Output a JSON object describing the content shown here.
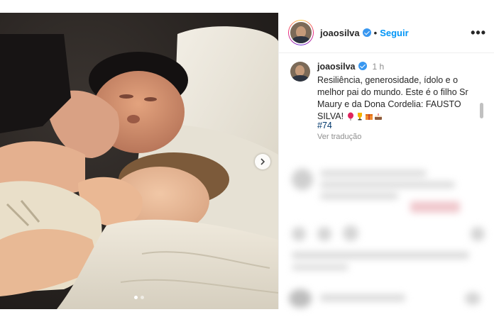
{
  "post": {
    "username": "joaosilva",
    "follow_label": "Seguir",
    "separator": "•",
    "more_label": "•••",
    "time": "1 h",
    "caption": "Resiliência, generosidade, ídolo e o melhor pai do mundo. Este é o filho Sr Maury e da Dona Cordelia: FAUSTO SILVA!",
    "hashtag": "#74",
    "translate_label": "Ver tradução",
    "emojis": [
      "balloon-icon",
      "trophy-icon",
      "gift-icon",
      "cake-icon"
    ]
  },
  "carousel": {
    "current": 1,
    "total": 2
  },
  "colors": {
    "accent": "#0095f6",
    "verified": "#3897f0",
    "hashtag": "#00376b"
  }
}
